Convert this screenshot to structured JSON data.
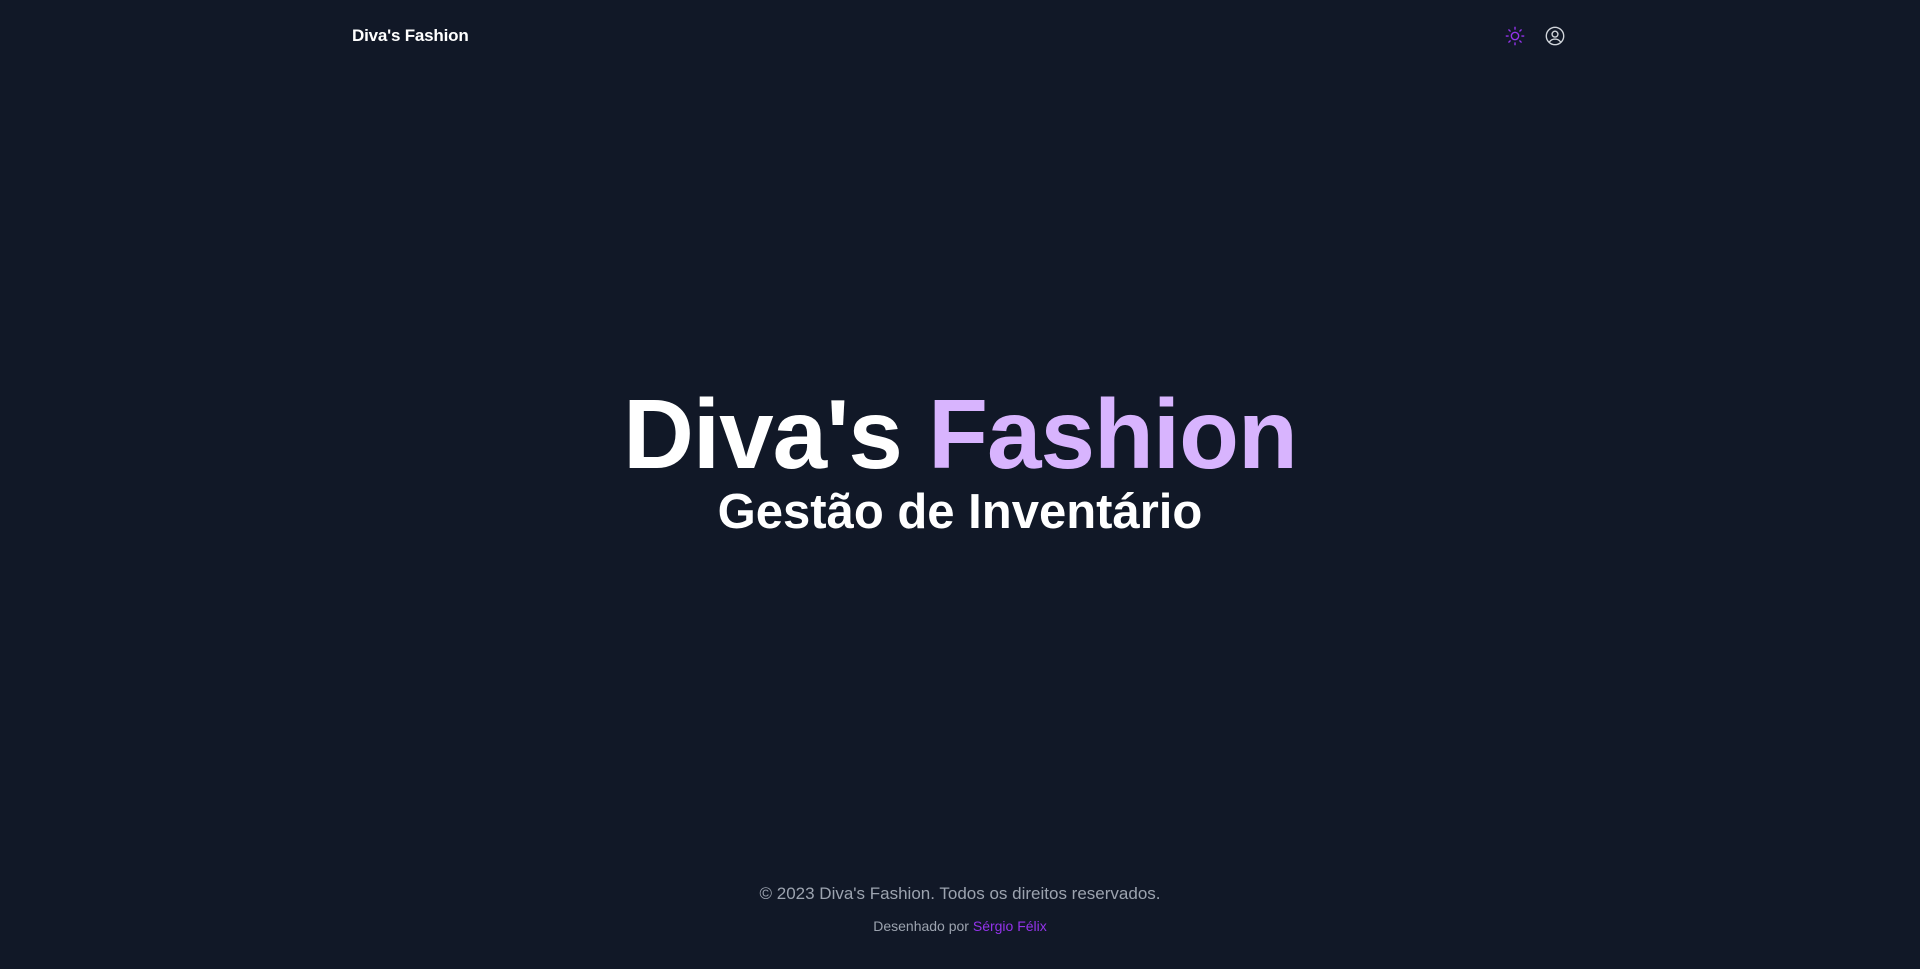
{
  "navbar": {
    "brand": "Diva's Fashion",
    "theme_toggle_icon": "sun-icon",
    "account_icon": "user-circle-icon"
  },
  "hero": {
    "title_part1": "Diva's ",
    "title_part2": "Fashion",
    "subtitle": "Gestão de Inventário"
  },
  "footer": {
    "copyright": "© 2023 Diva's Fashion. Todos os direitos reservados.",
    "credit_prefix": "Desenhado por ",
    "credit_author": "Sérgio Félix"
  },
  "colors": {
    "background": "#111827",
    "accent": "#d8b4fe",
    "link": "#9333ea",
    "muted": "#9ca3af"
  }
}
